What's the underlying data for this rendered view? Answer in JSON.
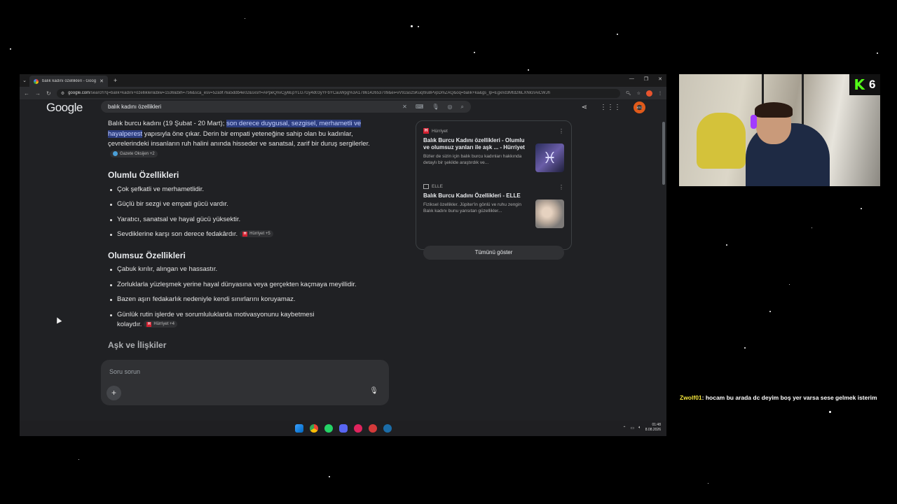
{
  "browser": {
    "tab_title": "balık kadını özellikleri - Google",
    "url_host": "google.com",
    "url_rest": "/search?q=balık+kadını+özellikleri&biw=1536&bih=756&sca_esv=52a9f76a5ddb4e02&sxsrf=APpeQnvCjy6EpYLG7Gy4d03yYFbYCauWpg%3A1786142653709&ei=vV92asz5KuqI9u8PvpDmZAQ&oq=balık+ka&gs_lp=Egxnd3Mtd2l6LXNlcnAiCWJh"
  },
  "google": {
    "logo": "Google",
    "query": "balık kadını özellikleri",
    "intro_plain_1": "Balık burcu kadını (19 Şubat - 20 Mart); ",
    "intro_highlight": "son derece duygusal, sezgisel, merhametli ve hayalperest",
    "intro_plain_2": " yapısıyla öne çıkar. Derin bir empati yeteneğine sahip olan bu kadınlar, çevrelerindeki insanların ruh halini anında hisseder ve sanatsal, zarif bir duruş sergilerler.",
    "intro_chip": "Gazete Oksijen +2",
    "section1_title": "Olumlu Özellikleri",
    "section1_items": [
      "Çok şefkatli ve merhametlidir.",
      "Güçlü bir sezgi ve empati gücü vardır.",
      "Yaratıcı, sanatsal ve hayal gücü yüksektir.",
      "Sevdiklerine karşı son derece fedakârdır."
    ],
    "section1_chip": "Hürriyet +5",
    "section2_title": "Olumsuz Özellikleri",
    "section2_items": [
      "Çabuk kırılır, alıngan ve hassastır.",
      "Zorluklarla yüzleşmek yerine hayal dünyasına veya gerçekten kaçmaya meyillidir.",
      "Bazen aşırı fedakarlık nedeniyle kendi sınırlarını koruyamaz.",
      "Günlük rutin işlerde ve sorumluluklarda motivasyonunu kaybetmesi kolaydır."
    ],
    "section2_chip": "Hürriyet +4",
    "section3_title": "Aşk ve İlişkiler",
    "ask_placeholder": "Soru sorun",
    "sources": [
      {
        "site": "Hürriyet",
        "title": "Balık Burcu Kadını özellikleri - Olumlu ve olumsuz yanları ile aşk ... - Hürriyet",
        "desc": "Bizler de sizin için balık burcu kadınları hakkında detaylı bir şekilde araştırdık ve...",
        "thumb_icon": "pisces-symbol"
      },
      {
        "site": "ELLE",
        "title": "Balık Burcu Kadını Özellikleri - ELLE",
        "desc": "Fiziksel özellikler. Jüpiter'in gönlü ve ruhu zengin Balık kadını bunu yansıtan güzellikler...",
        "thumb_icon": "portrait-photo"
      }
    ],
    "show_all": "Tümünü göster"
  },
  "taskbar": {
    "time": "01:48",
    "date": "8.08.2026"
  },
  "overlay": {
    "badge_letter": "K",
    "badge_number": "6",
    "chat_user": "Zwolf01",
    "chat_message": ": hocam bu arada dc deyim boş yer varsa sese gelmek isterim"
  }
}
